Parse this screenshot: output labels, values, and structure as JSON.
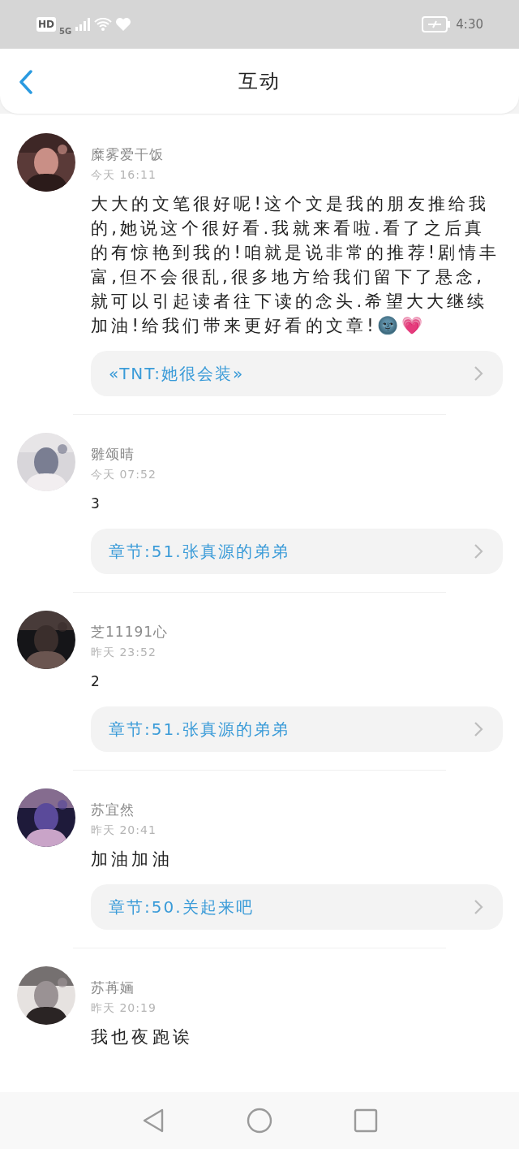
{
  "status_bar": {
    "hd_label": "HD",
    "network": "5G",
    "time": "4:30"
  },
  "header": {
    "title": "互动"
  },
  "comments": [
    {
      "user": "糜雾爱干饭",
      "time": "今天 16:11",
      "text": "大大的文笔很好呢!这个文是我的朋友推给我的,她说这个很好看.我就来看啦.看了之后真的有惊艳到我的!咱就是说非常的推荐!剧情丰富,但不会很乱,很多地方给我们留下了悬念,就可以引起读者往下读的念头.希望大大继续加油!给我们带来更好看的文章!🌚💗",
      "link": "«TNT:她很会装»"
    },
    {
      "user": "雛颂晴",
      "time": "今天 07:52",
      "text": "3",
      "link": "章节:51.张真源的弟弟"
    },
    {
      "user": "芝11191心",
      "time": "昨天 23:52",
      "text": "2",
      "link": "章节:51.张真源的弟弟"
    },
    {
      "user": "苏宜然",
      "time": "昨天 20:41",
      "text": "加油加油",
      "link": "章节:50.关起来吧"
    },
    {
      "user": "苏苒婳",
      "time": "昨天 20:19",
      "text": "我也夜跑诶"
    }
  ]
}
